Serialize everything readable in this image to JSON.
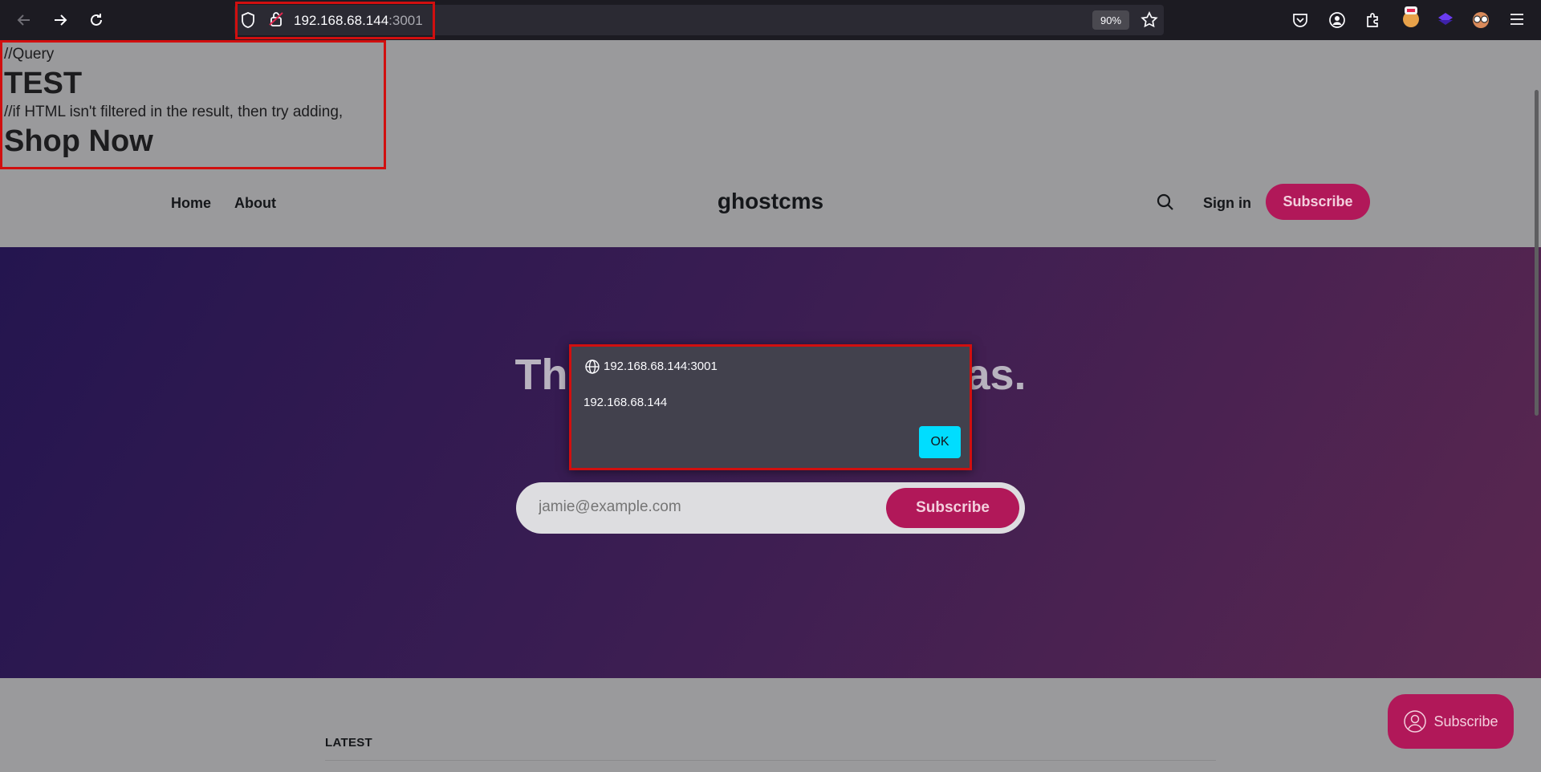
{
  "browser": {
    "url_host": "192.168.68.144",
    "url_port": ":3001",
    "zoom": "90%"
  },
  "injected": {
    "query": "//Query",
    "test": "TEST",
    "note": "//if HTML isn't filtered in the result, then try adding,",
    "shop": "Shop Now"
  },
  "header": {
    "nav": [
      "Home",
      "About"
    ],
    "title": "ghostcms",
    "signin": "Sign in",
    "subscribe": "Subscribe"
  },
  "hero": {
    "headline_left": "Tho",
    "headline_right": "eas.",
    "email_placeholder": "jamie@example.com",
    "subscribe": "Subscribe"
  },
  "main": {
    "latest": "LATEST"
  },
  "floating": {
    "subscribe": "Subscribe"
  },
  "dialog": {
    "origin": "192.168.68.144:3001",
    "message": "192.168.68.144",
    "ok": "OK"
  },
  "colors": {
    "accent": "#b11859",
    "ok_button": "#00ddff",
    "highlight": "#d10f0f"
  }
}
